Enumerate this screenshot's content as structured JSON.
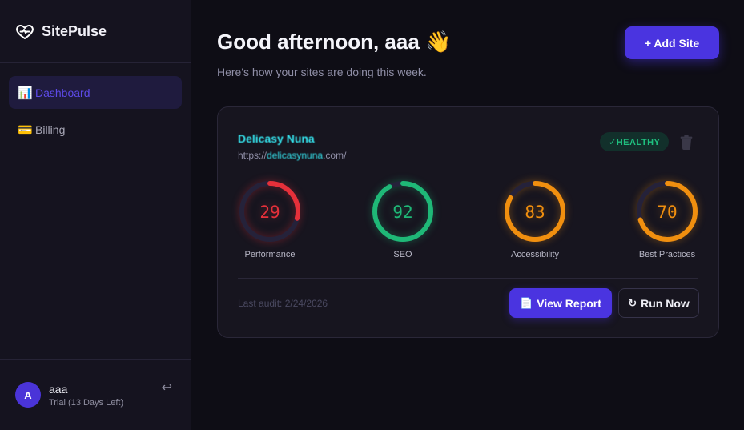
{
  "brand": {
    "name": "SitePulse",
    "logo_icon": "heart-pulse-icon"
  },
  "nav": [
    {
      "icon": "📊",
      "label": "Dashboard",
      "active": true
    },
    {
      "icon": "💳",
      "label": "Billing",
      "active": false
    }
  ],
  "user": {
    "initial": "A",
    "name": "aaa",
    "plan": "Trial (13 Days Left)",
    "logout_icon": "↩"
  },
  "header": {
    "greeting": "Good afternoon, aaa 👋",
    "subtitle": "Here's how your sites are doing this week.",
    "add_site_label": "+ Add Site"
  },
  "site": {
    "name": "Delicasy Nuna",
    "url_prefix": "https://",
    "url_redacted": "delicasynuna",
    "url_suffix": ".com/",
    "status": "✓HEALTHY",
    "last_audit": "Last audit: 2/24/2026",
    "view_report_icon": "📄",
    "view_report_label": "View Report",
    "run_now_icon": "↻",
    "run_now_label": "Run Now"
  },
  "scores": [
    {
      "label": "Performance",
      "value": 29,
      "color": "#e5303a"
    },
    {
      "label": "SEO",
      "value": 92,
      "color": "#1fb877"
    },
    {
      "label": "Accessibility",
      "value": 83,
      "color": "#f08f0f"
    },
    {
      "label": "Best Practices",
      "value": 70,
      "color": "#f08f0f"
    }
  ],
  "colors": {
    "accent": "#4a34e0",
    "healthy": "#1fbf7f"
  }
}
